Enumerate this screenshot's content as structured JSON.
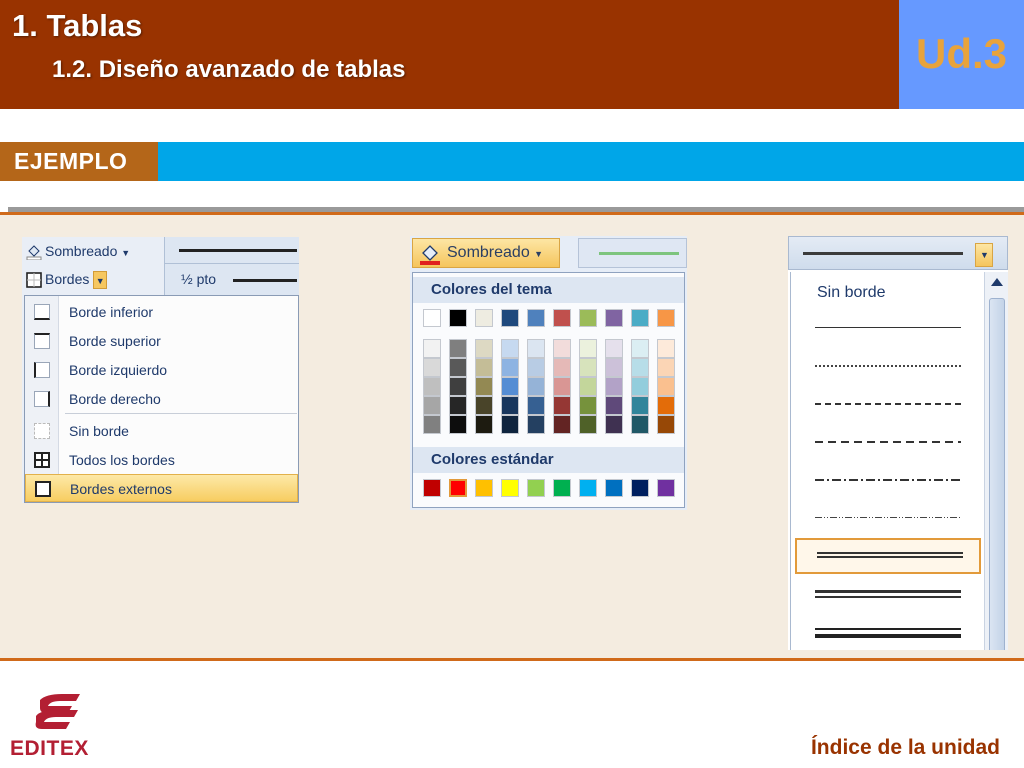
{
  "header": {
    "title": "1. Tablas",
    "subtitle": "1.2. Diseño avanzado de tablas",
    "unit": "Ud.3"
  },
  "example_tag": "EJEMPLO",
  "shot1": {
    "shading_button": "Sombreado",
    "borders_button": "Bordes",
    "line_weight": "½ pto",
    "menu_items": [
      "Borde inferior",
      "Borde superior",
      "Borde izquierdo",
      "Borde derecho",
      "Sin borde",
      "Todos los bordes",
      "Bordes externos"
    ],
    "selected_item": "Bordes externos"
  },
  "shot2": {
    "shading_button": "Sombreado",
    "theme_colors_label": "Colores del tema",
    "standard_colors_label": "Colores estándar",
    "theme_top_row": [
      "#ffffff",
      "#000000",
      "#eeece1",
      "#1f497d",
      "#4f81bd",
      "#c0504d",
      "#9bbb59",
      "#8064a2",
      "#4bacc6",
      "#f79646"
    ],
    "theme_shades": [
      [
        "#f2f2f2",
        "#d9d9d9",
        "#bfbfbf",
        "#a6a6a6",
        "#808080"
      ],
      [
        "#7f7f7f",
        "#595959",
        "#3f3f3f",
        "#262626",
        "#0d0d0d"
      ],
      [
        "#ddd9c3",
        "#c4bd97",
        "#938953",
        "#494429",
        "#1d1b10"
      ],
      [
        "#c6d9f0",
        "#8db3e2",
        "#548dd4",
        "#17365d",
        "#0f243e"
      ],
      [
        "#dbe5f1",
        "#b8cce4",
        "#95b3d7",
        "#366092",
        "#244061"
      ],
      [
        "#f2dcdb",
        "#e5b9b7",
        "#d99694",
        "#953734",
        "#632423"
      ],
      [
        "#ebf1dd",
        "#d7e3bc",
        "#c3d69b",
        "#76923c",
        "#4f6128"
      ],
      [
        "#e5e0ec",
        "#ccc1d9",
        "#b2a2c7",
        "#5f497a",
        "#3f3151"
      ],
      [
        "#dbeef3",
        "#b7dde8",
        "#92cddc",
        "#31859b",
        "#205867"
      ],
      [
        "#fdeada",
        "#fbd5b5",
        "#fac08f",
        "#e36c09",
        "#974806"
      ]
    ],
    "standard_colors": [
      "#c00000",
      "#ff0000",
      "#ffc000",
      "#ffff00",
      "#92d050",
      "#00b050",
      "#00b0f0",
      "#0070c0",
      "#002060",
      "#7030a0"
    ]
  },
  "shot3": {
    "no_border_label": "Sin borde"
  },
  "footer": {
    "brand": "EDITEX",
    "index_link": "Índice de la unidad"
  }
}
